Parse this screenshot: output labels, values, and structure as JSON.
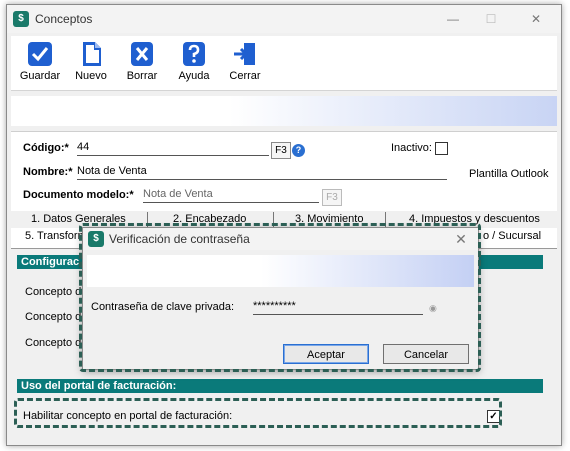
{
  "window": {
    "title": "Conceptos",
    "minimize_glyph": "—",
    "maximize_glyph": "☐",
    "close_glyph": "✕"
  },
  "toolbar": {
    "items": [
      {
        "label": "Guardar",
        "icon": "check-icon"
      },
      {
        "label": "Nuevo",
        "icon": "new-document-icon"
      },
      {
        "label": "Borrar",
        "icon": "delete-icon"
      },
      {
        "label": "Ayuda",
        "icon": "help-icon"
      },
      {
        "label": "Cerrar",
        "icon": "exit-icon"
      }
    ]
  },
  "form": {
    "codigo_label": "Código:*",
    "codigo_value": "44",
    "f3_label": "F3",
    "inactivo_label": "Inactivo:",
    "nombre_label": "Nombre:*",
    "nombre_value": "Nota de Venta",
    "plantilla_label": "Plantilla Outlook",
    "documento_label": "Documento modelo:*",
    "documento_placeholder": "Nota de Venta"
  },
  "tabs": {
    "row1": [
      "1. Datos Generales",
      "2. Encabezado",
      "3. Movimiento",
      "4. Impuestos y descuentos"
    ],
    "row2_left": "5. Transform",
    "row2_right": "o / Sucursal"
  },
  "panel": {
    "config_header": "Configurac",
    "concepto_1": "Concepto de",
    "concepto_2": "Concepto de",
    "concepto_3": "Concepto de",
    "portal_header": "Uso del portal de facturación:",
    "habilitar_label": "Habilitar concepto en portal de facturación:",
    "habilitar_checked": "✓"
  },
  "dialog": {
    "title": "Verificación de contraseña",
    "close_glyph": "✕",
    "password_label": "Contraseña de clave privada:",
    "password_value": "**********",
    "accept_label": "Aceptar",
    "cancel_label": "Cancelar"
  },
  "colors": {
    "section_header": "#0a7a7a",
    "dashed_highlight": "#2c5f55",
    "accent_blue": "#2a6fd1"
  }
}
